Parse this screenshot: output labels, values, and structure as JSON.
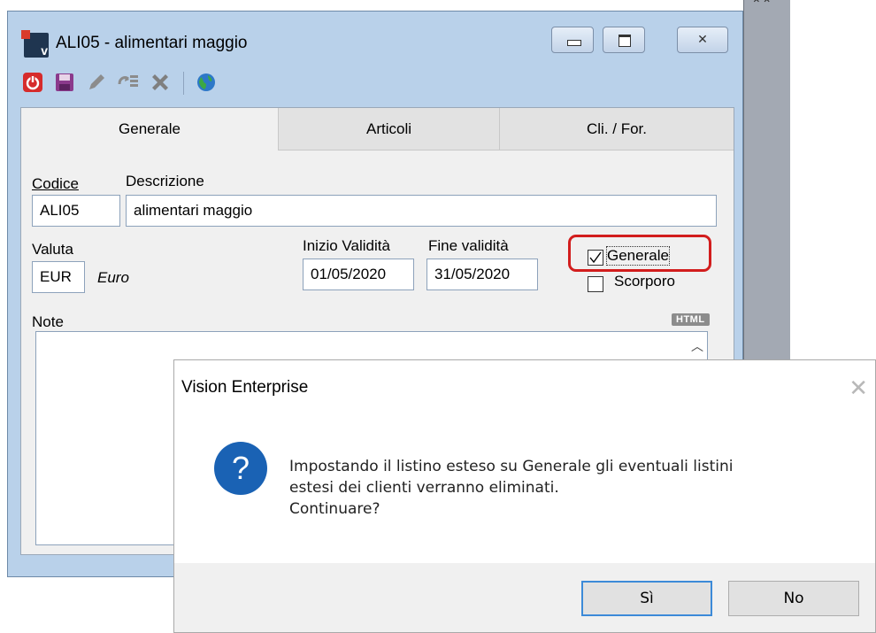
{
  "window": {
    "title": "ALI05 - alimentari maggio",
    "app_icon_letter": "v"
  },
  "toolbar": {
    "icons": [
      "power-icon",
      "save-icon",
      "edit-pencil-icon",
      "copy-list-icon",
      "delete-x-icon",
      "globe-icon"
    ]
  },
  "tabs": [
    {
      "label": "Generale",
      "active": true
    },
    {
      "label": "Articoli",
      "active": false
    },
    {
      "label": "Cli. / For.",
      "active": false
    }
  ],
  "form": {
    "codice_label": "Codice",
    "codice_value": "ALI05",
    "descrizione_label": "Descrizione",
    "descrizione_value": "alimentari maggio",
    "valuta_label": "Valuta",
    "valuta_value": "EUR",
    "valuta_name": "Euro",
    "inizio_label": "Inizio Validità",
    "inizio_value": "01/05/2020",
    "fine_label": "Fine validità",
    "fine_value": "31/05/2020",
    "generale_label": "Generale",
    "generale_checked": true,
    "scorporo_label": "Scorporo",
    "scorporo_checked": false,
    "note_label": "Note",
    "html_badge": "HTML",
    "highlight_color": "#d21d1d"
  },
  "dialog": {
    "title": "Vision Enterprise",
    "message_lines": [
      "Impostando il listino esteso su Generale gli eventuali listini",
      "estesi dei clienti verranno eliminati.",
      "Continuare?"
    ],
    "icon": "question-icon",
    "icon_glyph": "?",
    "yes_label": "Sì",
    "no_label": "No",
    "accent_color": "#1a62b4"
  }
}
